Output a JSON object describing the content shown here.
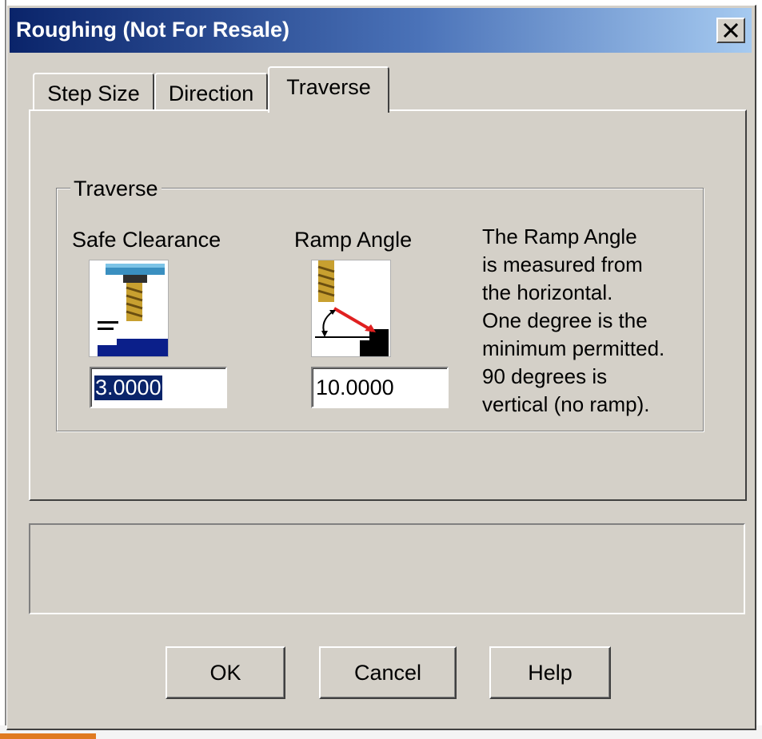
{
  "window": {
    "title": "Roughing (Not For Resale)",
    "close_icon": "close-icon"
  },
  "tabs": [
    {
      "label": "Step Size",
      "active": false
    },
    {
      "label": "Direction",
      "active": false
    },
    {
      "label": "Traverse",
      "active": true
    }
  ],
  "traverse": {
    "group_label": "Traverse",
    "safe_clearance": {
      "label": "Safe Clearance",
      "value": "3.0000",
      "icon": "safe-clearance-tool-icon"
    },
    "ramp_angle": {
      "label": "Ramp Angle",
      "value": "10.0000",
      "icon": "ramp-angle-tool-icon"
    },
    "description_lines": [
      "The Ramp Angle",
      "is measured from",
      "the horizontal.",
      "One degree is the",
      "minimum permitted.",
      "90 degrees is",
      "vertical (no ramp)."
    ]
  },
  "buttons": {
    "ok": "OK",
    "cancel": "Cancel",
    "help": "Help"
  },
  "colors": {
    "titlebar_start": "#0a246a",
    "titlebar_end": "#a6caf0",
    "face": "#d4d0c8",
    "selection": "#0a246a"
  }
}
